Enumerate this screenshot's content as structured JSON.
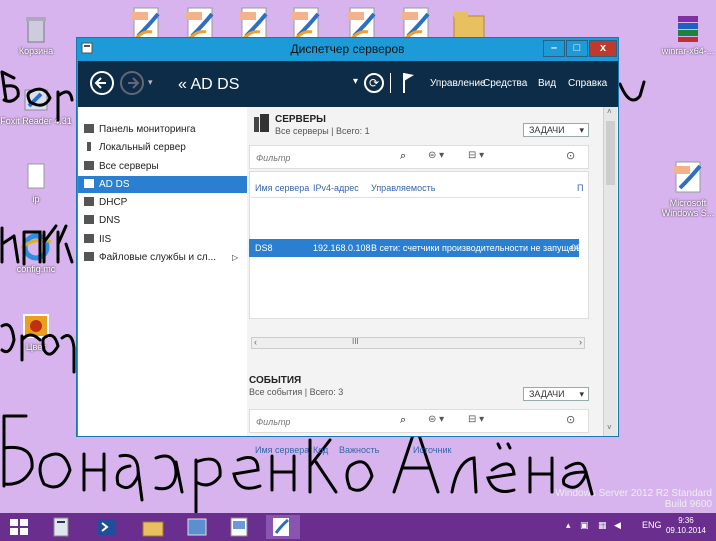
{
  "desktop": {
    "icons": [
      {
        "label": "Корзина",
        "name": "recycle-bin"
      },
      {
        "label": "Foxit Reader 4.31",
        "name": "foxit-reader"
      },
      {
        "label": "ip",
        "name": "ip-file"
      },
      {
        "label": "config.mc",
        "name": "config-file"
      },
      {
        "label": "Цвет",
        "name": "color-image"
      },
      {
        "label": "winrar-x64-...",
        "name": "winrar"
      },
      {
        "label": "Microsoft Windows S...",
        "name": "microsoft-pdf"
      }
    ],
    "handwriting": "Бондаренко Алёна",
    "watermark_line1": "Windows Server 2012 R2 Standard",
    "watermark_line2": "Build 9600"
  },
  "window": {
    "title": "Диспетчер серверов",
    "breadcrumb": "« AD DS",
    "menu": {
      "manage": "Управление",
      "tools": "Средства",
      "view": "Вид",
      "help": "Справка"
    }
  },
  "sidebar": {
    "items": [
      {
        "label": "Панель мониторинга"
      },
      {
        "label": "Локальный сервер"
      },
      {
        "label": "Все серверы"
      },
      {
        "label": "AD DS"
      },
      {
        "label": "DHCP"
      },
      {
        "label": "DNS"
      },
      {
        "label": "IIS"
      },
      {
        "label": "Файловые службы и сл..."
      }
    ],
    "selected": "AD DS"
  },
  "servers": {
    "title": "СЕРВЕРЫ",
    "subtitle": "Все серверы | Всего: 1",
    "tasks": "ЗАДАЧИ",
    "filter_placeholder": "Фильтр",
    "columns": [
      "Имя сервера",
      "IPv4-адрес",
      "Управляемость",
      "П"
    ],
    "rows": [
      {
        "name": "DS8",
        "ip": "192.168.0.108",
        "status": "В сети: счетчики производительности не запущены",
        "extra": "09"
      }
    ]
  },
  "events": {
    "title": "СОБЫТИЯ",
    "subtitle": "Все события | Всего: 3",
    "tasks": "ЗАДАЧИ",
    "filter_placeholder": "Фильтр",
    "columns": [
      "Имя сервера",
      "Код",
      "Важность",
      "Источник"
    ]
  },
  "taskbar": {
    "language": "ENG",
    "time": "9:36",
    "date": "09.10.2014"
  },
  "colors": {
    "desktop": "#d8b4ee",
    "taskbar": "#6a2e8f",
    "window_frame": "#1c9bd8",
    "header": "#0d2c47",
    "selection": "#2a7fd0"
  }
}
